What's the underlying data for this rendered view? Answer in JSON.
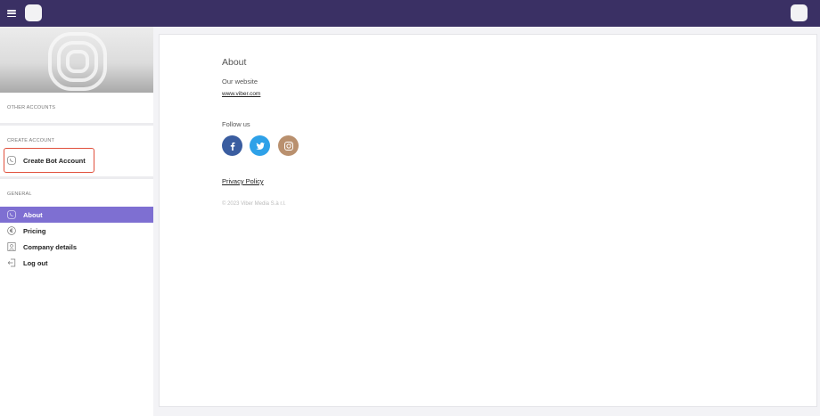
{
  "sidebar": {
    "other_accounts_label": "OTHER ACCOUNTS",
    "create_account_label": "CREATE ACCOUNT",
    "create_bot_label": "Create Bot Account",
    "general_label": "GENERAL",
    "items": [
      {
        "label": "About",
        "icon": "viber-icon",
        "active": true
      },
      {
        "label": "Pricing",
        "icon": "euro-icon",
        "active": false
      },
      {
        "label": "Company details",
        "icon": "building-icon",
        "active": false
      },
      {
        "label": "Log out",
        "icon": "logout-icon",
        "active": false
      }
    ]
  },
  "main": {
    "title": "About",
    "website_label": "Our website",
    "website_link": "www.viber.com",
    "follow_label": "Follow us",
    "social": [
      {
        "name": "facebook",
        "color": "#3a5da0"
      },
      {
        "name": "twitter",
        "color": "#2ea1e8"
      },
      {
        "name": "instagram",
        "color": "#b9906e"
      }
    ],
    "privacy_label": "Privacy Policy",
    "copyright": "© 2023 Viber Media S.à r.l."
  },
  "colors": {
    "topbar": "#3a3064",
    "active_item": "#7e6fd2",
    "highlight": "#e0503c"
  }
}
